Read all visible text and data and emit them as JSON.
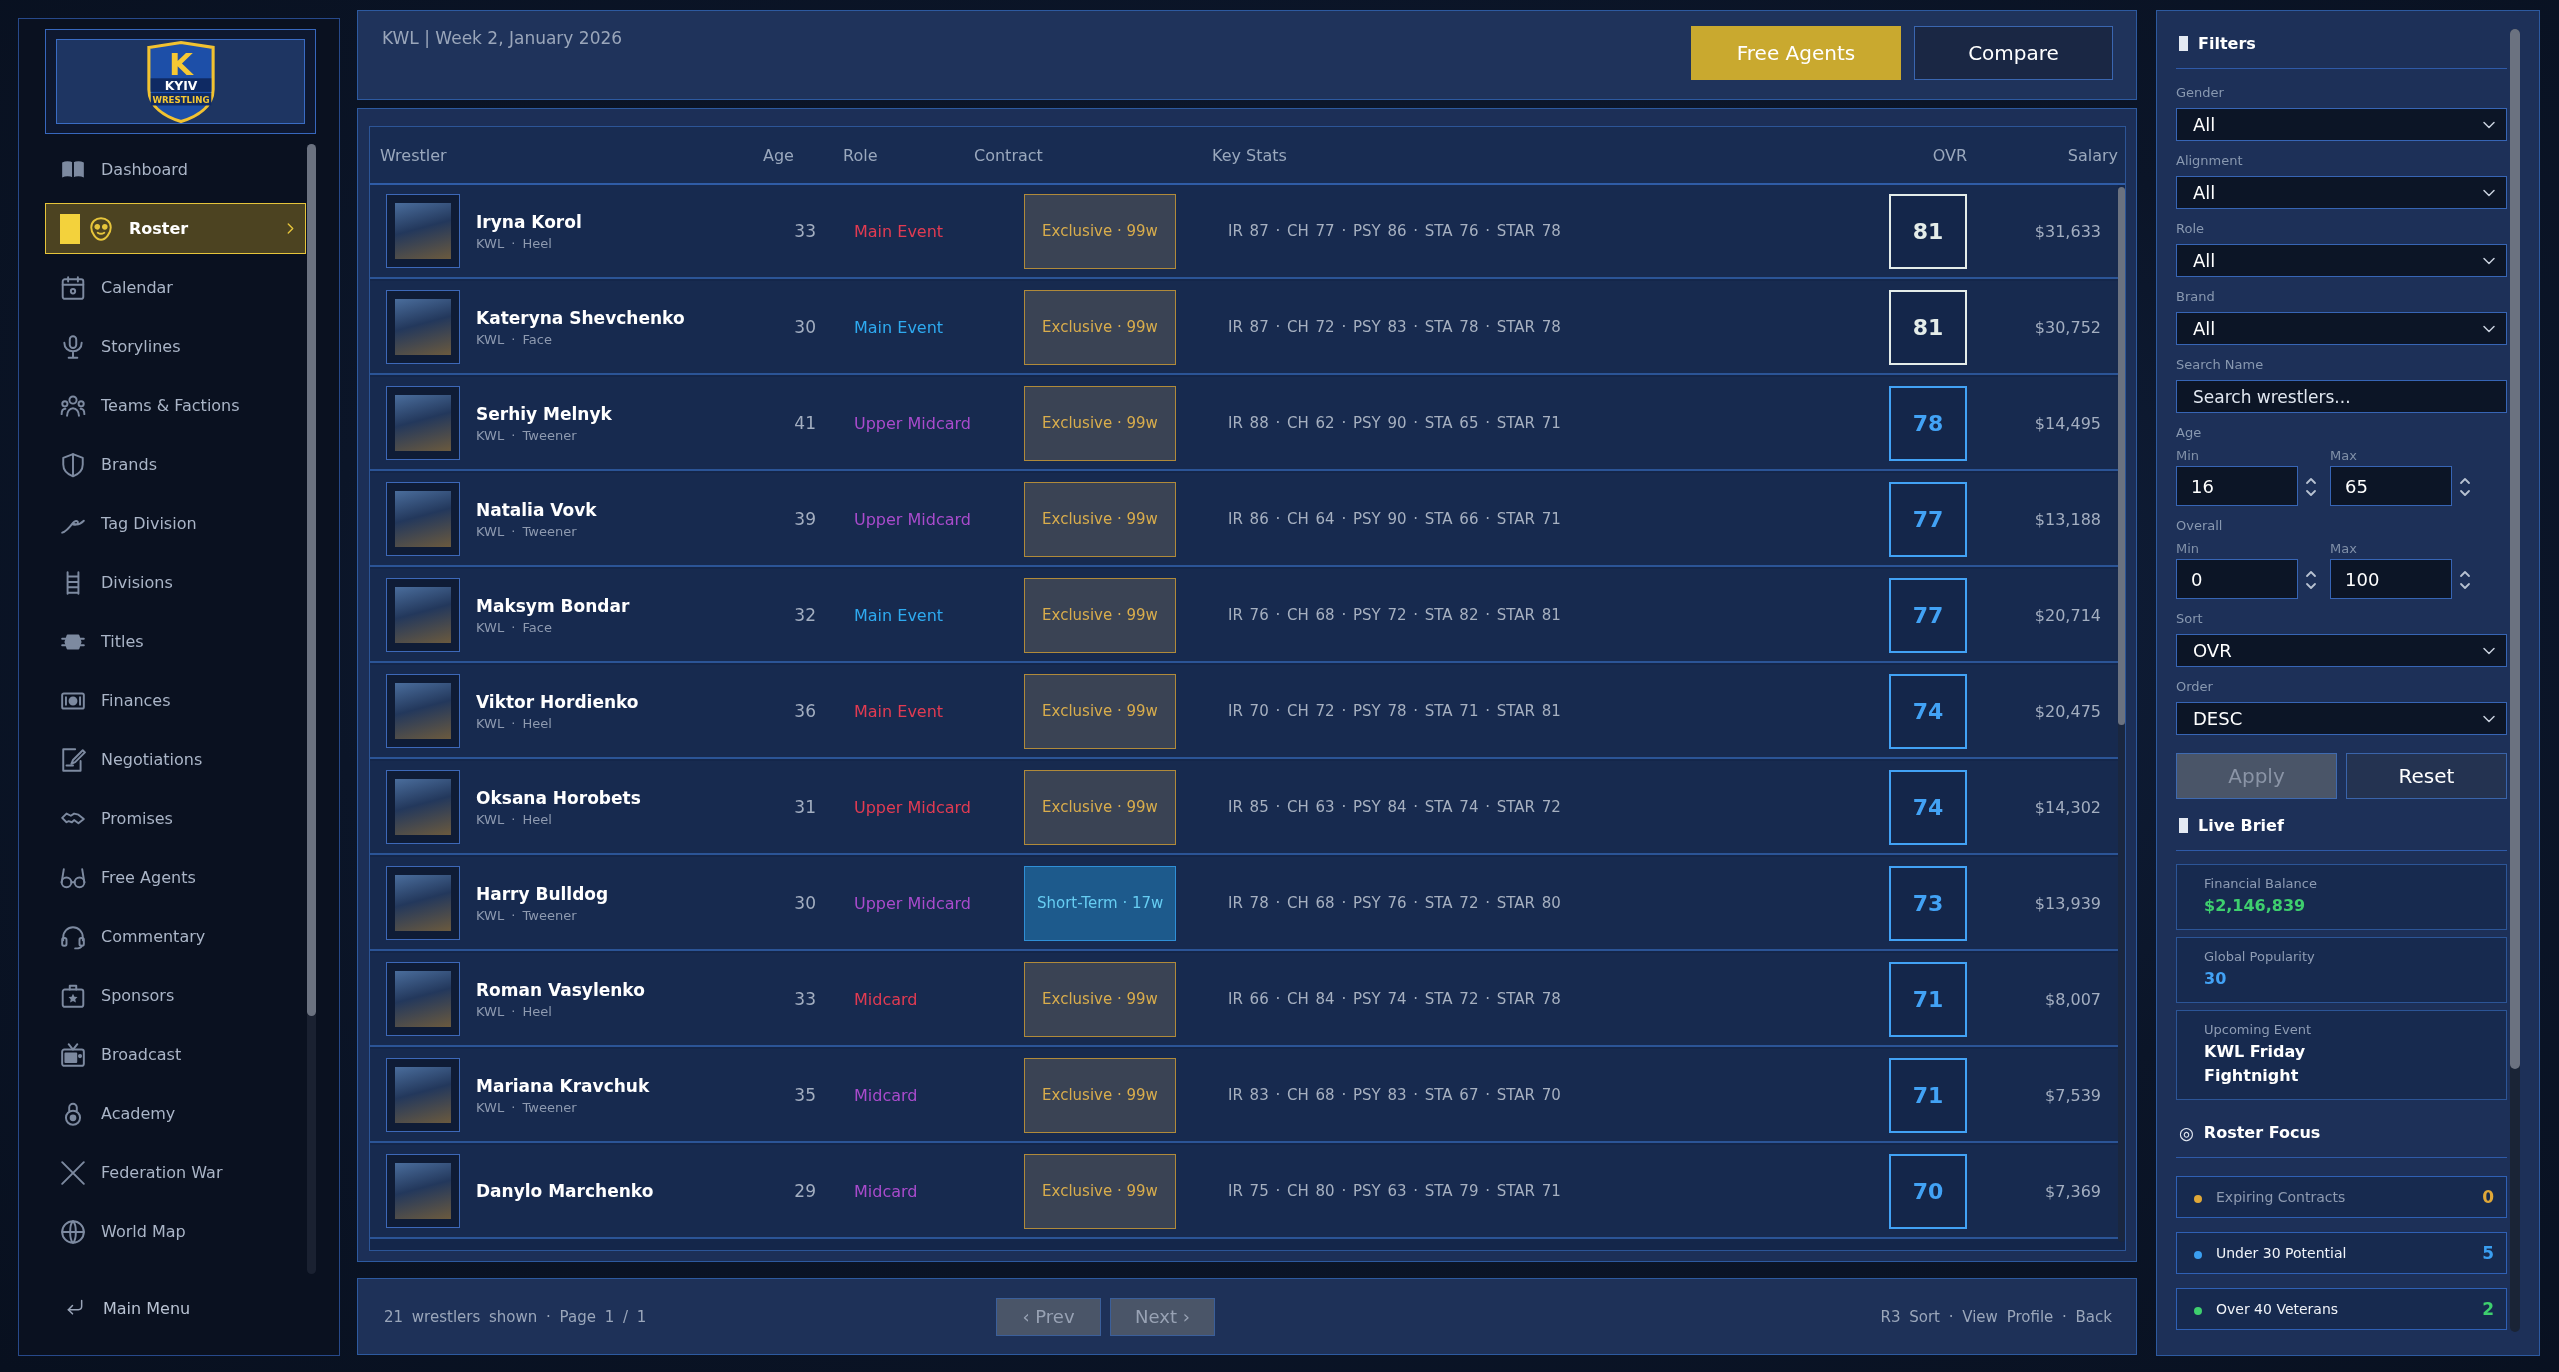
{
  "sidebar": {
    "logo": {
      "letter": "K",
      "title": "KYIV",
      "subtitle": "WRESTLING"
    },
    "items": [
      {
        "label": "Dashboard",
        "selected": false
      },
      {
        "label": "Roster",
        "selected": true
      },
      {
        "label": "Calendar",
        "selected": false
      },
      {
        "label": "Storylines",
        "selected": false
      },
      {
        "label": "Teams & Factions",
        "selected": false
      },
      {
        "label": "Brands",
        "selected": false
      },
      {
        "label": "Tag Division",
        "selected": false
      },
      {
        "label": "Divisions",
        "selected": false
      },
      {
        "label": "Titles",
        "selected": false
      },
      {
        "label": "Finances",
        "selected": false
      },
      {
        "label": "Negotiations",
        "selected": false
      },
      {
        "label": "Promises",
        "selected": false
      },
      {
        "label": "Free Agents",
        "selected": false
      },
      {
        "label": "Commentary",
        "selected": false
      },
      {
        "label": "Sponsors",
        "selected": false
      },
      {
        "label": "Broadcast",
        "selected": false
      },
      {
        "label": "Academy",
        "selected": false
      },
      {
        "label": "Federation War",
        "selected": false
      },
      {
        "label": "World Map",
        "selected": false
      }
    ],
    "main_menu": {
      "label": "Main Menu"
    }
  },
  "header": {
    "title": "KWL | Week 2, January 2026",
    "buttons": [
      {
        "label": "Free Agents",
        "kind": "primary"
      },
      {
        "label": "Compare",
        "kind": "secondary"
      }
    ]
  },
  "table": {
    "columns": [
      "Wrestler",
      "Age",
      "Role",
      "Contract",
      "Key Stats",
      "OVR",
      "Salary"
    ],
    "rows": [
      {
        "name": "Iryna Korol",
        "sub": "KWL · Heel",
        "age": "33",
        "role": {
          "label": "Main Event",
          "color": "#e23b52"
        },
        "contract": {
          "label": "Exclusive · 99w",
          "kind": "exclusive"
        },
        "stats": "IR 87 · CH 77 · PSY 86 · STA 76 · STAR 78",
        "ovr": {
          "value": "81",
          "color": "#e4ece9"
        },
        "salary": "$31,633"
      },
      {
        "name": "Kateryna Shevchenko",
        "sub": "KWL · Face",
        "age": "30",
        "role": {
          "label": "Main Event",
          "color": "#2eaaf0"
        },
        "contract": {
          "label": "Exclusive · 99w",
          "kind": "exclusive"
        },
        "stats": "IR 87 · CH 72 · PSY 83 · STA 78 · STAR 78",
        "ovr": {
          "value": "81",
          "color": "#e4ece9"
        },
        "salary": "$30,752"
      },
      {
        "name": "Serhiy Melnyk",
        "sub": "KWL · Tweener",
        "age": "41",
        "role": {
          "label": "Upper Midcard",
          "color": "#a94bcc"
        },
        "contract": {
          "label": "Exclusive · 99w",
          "kind": "exclusive"
        },
        "stats": "IR 88 · CH 62 · PSY 90 · STA 65 · STAR 71",
        "ovr": {
          "value": "78",
          "color": "#42a2f5"
        },
        "salary": "$14,495"
      },
      {
        "name": "Natalia Vovk",
        "sub": "KWL · Tweener",
        "age": "39",
        "role": {
          "label": "Upper Midcard",
          "color": "#a94bcc"
        },
        "contract": {
          "label": "Exclusive · 99w",
          "kind": "exclusive"
        },
        "stats": "IR 86 · CH 64 · PSY 90 · STA 66 · STAR 71",
        "ovr": {
          "value": "77",
          "color": "#42a2f5"
        },
        "salary": "$13,188"
      },
      {
        "name": "Maksym Bondar",
        "sub": "KWL · Face",
        "age": "32",
        "role": {
          "label": "Main Event",
          "color": "#2eaaf0"
        },
        "contract": {
          "label": "Exclusive · 99w",
          "kind": "exclusive"
        },
        "stats": "IR 76 · CH 68 · PSY 72 · STA 82 · STAR 81",
        "ovr": {
          "value": "77",
          "color": "#42a2f5"
        },
        "salary": "$20,714"
      },
      {
        "name": "Viktor Hordienko",
        "sub": "KWL · Heel",
        "age": "36",
        "role": {
          "label": "Main Event",
          "color": "#e23b52"
        },
        "contract": {
          "label": "Exclusive · 99w",
          "kind": "exclusive"
        },
        "stats": "IR 70 · CH 72 · PSY 78 · STA 71 · STAR 81",
        "ovr": {
          "value": "74",
          "color": "#42a2f5"
        },
        "salary": "$20,475"
      },
      {
        "name": "Oksana Horobets",
        "sub": "KWL · Heel",
        "age": "31",
        "role": {
          "label": "Upper Midcard",
          "color": "#e23b52"
        },
        "contract": {
          "label": "Exclusive · 99w",
          "kind": "exclusive"
        },
        "stats": "IR 85 · CH 63 · PSY 84 · STA 74 · STAR 72",
        "ovr": {
          "value": "74",
          "color": "#42a2f5"
        },
        "salary": "$14,302"
      },
      {
        "name": "Harry Bulldog",
        "sub": "KWL · Tweener",
        "age": "30",
        "role": {
          "label": "Upper Midcard",
          "color": "#a94bcc"
        },
        "contract": {
          "label": "Short-Term · 17w",
          "kind": "short-term"
        },
        "stats": "IR 78 · CH 68 · PSY 76 · STA 72 · STAR 80",
        "ovr": {
          "value": "73",
          "color": "#42a2f5"
        },
        "salary": "$13,939"
      },
      {
        "name": "Roman Vasylenko",
        "sub": "KWL · Heel",
        "age": "33",
        "role": {
          "label": "Midcard",
          "color": "#e23b52"
        },
        "contract": {
          "label": "Exclusive · 99w",
          "kind": "exclusive"
        },
        "stats": "IR 66 · CH 84 · PSY 74 · STA 72 · STAR 78",
        "ovr": {
          "value": "71",
          "color": "#42a2f5"
        },
        "salary": "$8,007"
      },
      {
        "name": "Mariana Kravchuk",
        "sub": "KWL · Tweener",
        "age": "35",
        "role": {
          "label": "Midcard",
          "color": "#a94bcc"
        },
        "contract": {
          "label": "Exclusive · 99w",
          "kind": "exclusive"
        },
        "stats": "IR 83 · CH 68 · PSY 83 · STA 67 · STAR 70",
        "ovr": {
          "value": "71",
          "color": "#42a2f5"
        },
        "salary": "$7,539"
      },
      {
        "name": "Danylo Marchenko",
        "age": "29",
        "role": {
          "label": "Midcard",
          "color": "#a94bcc"
        },
        "contract": {
          "label": "Exclusive · 99w",
          "kind": "exclusive"
        },
        "stats": "IR 75 · CH 80 · PSY 63 · STA 79 · STAR 71",
        "ovr": {
          "value": "70",
          "color": "#42a2f5"
        },
        "salary": "$7,369"
      }
    ]
  },
  "footer": {
    "status": "21 wrestlers shown · Page 1 / 1",
    "pager": [
      {
        "label": "‹ Prev",
        "disabled": true
      },
      {
        "label": "Next ›",
        "disabled": true
      }
    ],
    "hints": "R3 Sort · View Profile · Back"
  },
  "filters": {
    "title": "Filters",
    "fields": [
      {
        "kind": "select",
        "label": "Gender",
        "value": "All"
      },
      {
        "kind": "select",
        "label": "Alignment",
        "value": "All"
      },
      {
        "kind": "select",
        "label": "Role",
        "value": "All"
      },
      {
        "kind": "select",
        "label": "Brand",
        "value": "All"
      },
      {
        "kind": "search",
        "label": "Search Name",
        "placeholder": "Search wrestlers..."
      },
      {
        "kind": "range",
        "label": "Age",
        "min": {
          "label": "Min",
          "value": "16"
        },
        "max": {
          "label": "Max",
          "value": "65"
        }
      },
      {
        "kind": "range",
        "label": "Overall",
        "min": {
          "label": "Min",
          "value": "0"
        },
        "max": {
          "label": "Max",
          "value": "100"
        }
      },
      {
        "kind": "select",
        "label": "Sort",
        "value": "OVR"
      },
      {
        "kind": "select",
        "label": "Order",
        "value": "DESC"
      }
    ],
    "buttons": [
      {
        "label": "Apply",
        "disabled": true
      },
      {
        "label": "Reset",
        "disabled": false
      }
    ]
  },
  "live_brief": {
    "title": "Live Brief",
    "cards": [
      {
        "label": "Financial Balance",
        "value": "$2,146,839",
        "color": "#3ecf6e"
      },
      {
        "label": "Global Popularity",
        "value": "30",
        "color": "#42a2f5"
      },
      {
        "label": "Upcoming Event",
        "value": "KWL Friday Fightnight",
        "color": "#ffffff"
      }
    ]
  },
  "roster_focus": {
    "icon": "◎",
    "title": "Roster Focus",
    "items": [
      {
        "label": "Expiring Contracts",
        "count": "0",
        "color": "#e0a838",
        "muted": true
      },
      {
        "label": "Under 30 Potential",
        "count": "5",
        "color": "#3a9ef0",
        "muted": false
      },
      {
        "label": "Over 40 Veterans",
        "count": "2",
        "color": "#3ecf6e",
        "muted": false
      }
    ]
  }
}
